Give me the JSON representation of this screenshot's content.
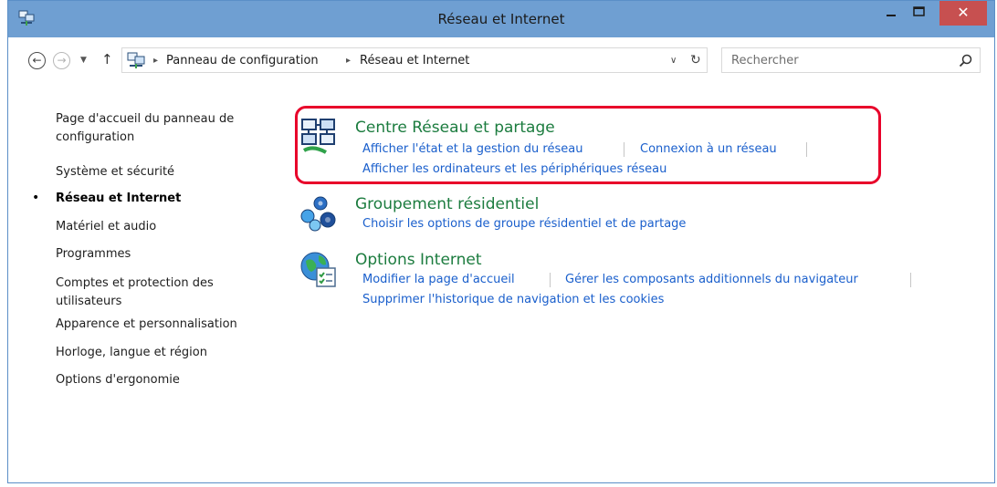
{
  "window": {
    "title": "Réseau et Internet",
    "close_glyph": "✕"
  },
  "navigation": {
    "back_glyph": "←",
    "forward_glyph": "→",
    "recent_glyph": "▼",
    "up_glyph": "↑"
  },
  "address_bar": {
    "crumbs": [
      "Panneau de configuration",
      "Réseau et Internet"
    ],
    "separator_glyph": "▸",
    "dropdown_glyph": "∨",
    "refresh_glyph": "↻"
  },
  "search": {
    "placeholder": "Rechercher"
  },
  "sidebar": {
    "items": [
      {
        "label_line1": "Page d'accueil du panneau de",
        "label_line2": "configuration"
      },
      {
        "label": "Système et sécurité"
      },
      {
        "label": "Réseau et Internet",
        "current": true
      },
      {
        "label": "Matériel et audio"
      },
      {
        "label": "Programmes"
      },
      {
        "label_line1": "Comptes et protection des",
        "label_line2": "utilisateurs"
      },
      {
        "label": "Apparence et personnalisation"
      },
      {
        "label": "Horloge, langue et région"
      },
      {
        "label": "Options d'ergonomie"
      }
    ],
    "bullet_glyph": "•"
  },
  "categories": [
    {
      "title": "Centre Réseau et partage",
      "links": [
        "Afficher l'état et la gestion du réseau",
        "Connexion à un réseau",
        "Afficher les ordinateurs et les périphériques réseau"
      ],
      "icon": "network-sharing-icon"
    },
    {
      "title": "Groupement résidentiel",
      "links": [
        "Choisir les options de groupe résidentiel et de partage"
      ],
      "icon": "homegroup-icon"
    },
    {
      "title": "Options Internet",
      "links": [
        "Modifier la page d'accueil",
        "Gérer les composants additionnels du navigateur",
        "Supprimer l'historique de navigation et les cookies"
      ],
      "icon": "internet-options-icon"
    }
  ],
  "colors": {
    "titlebar": "#6f9fd2",
    "close_button": "#c75050",
    "category_title": "#1c7c3f",
    "link": "#1a5fcc",
    "highlight": "#e8002a"
  }
}
